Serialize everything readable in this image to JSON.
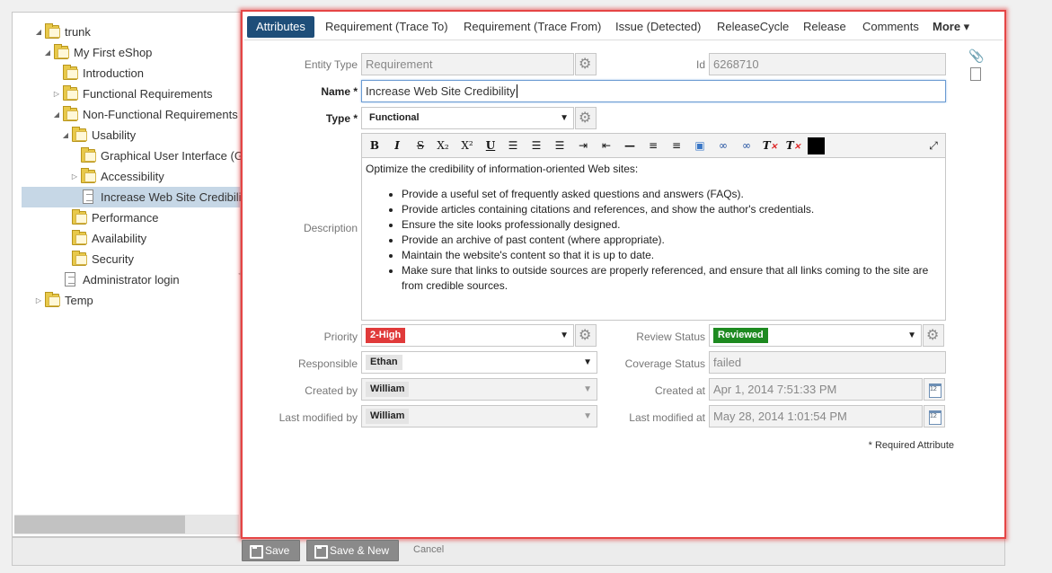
{
  "tree": {
    "items": [
      {
        "label": "trunk",
        "icon": "folder-icon",
        "arrow": "◢"
      },
      {
        "label": "My First eShop",
        "icon": "folder-icon",
        "arrow": "◢"
      },
      {
        "label": "Introduction",
        "icon": "folder-icon",
        "arrow": ""
      },
      {
        "label": "Functional Requirements",
        "icon": "folder-icon",
        "arrow": "▷"
      },
      {
        "label": "Non-Functional Requirements",
        "icon": "folder-icon",
        "arrow": "◢"
      },
      {
        "label": "Usability",
        "icon": "folder-icon",
        "arrow": "◢"
      },
      {
        "label": "Graphical User Interface (GU",
        "icon": "folder-icon",
        "arrow": ""
      },
      {
        "label": "Accessibility",
        "icon": "folder-icon",
        "arrow": "▷"
      },
      {
        "label": "Increase Web Site Credibility",
        "icon": "document-icon",
        "arrow": ""
      },
      {
        "label": "Performance",
        "icon": "folder-icon",
        "arrow": ""
      },
      {
        "label": "Availability",
        "icon": "folder-icon",
        "arrow": ""
      },
      {
        "label": "Security",
        "icon": "folder-icon",
        "arrow": ""
      },
      {
        "label": "Administrator login",
        "icon": "document-icon",
        "arrow": ""
      },
      {
        "label": "Temp",
        "icon": "folder-icon",
        "arrow": "▷"
      }
    ]
  },
  "tabs": [
    "Attributes",
    "Requirement (Trace To)",
    "Requirement (Trace From)",
    "Issue (Detected)",
    "ReleaseCycle",
    "Release",
    "Comments",
    "More ▾"
  ],
  "form": {
    "entity_type": {
      "label": "Entity Type",
      "value": "Requirement"
    },
    "id": {
      "label": "Id",
      "value": "6268710"
    },
    "name": {
      "label": "Name *",
      "value": "Increase Web Site Credibility"
    },
    "type": {
      "label": "Type *",
      "value": "Functional"
    },
    "description": {
      "label": "Description",
      "intro": "Optimize the credibility of information-oriented Web sites:",
      "bullets": [
        "Provide a useful set of frequently asked questions and answers (FAQs).",
        "Provide articles containing citations and references, and show the author's credentials.",
        "Ensure the site looks professionally designed.",
        "Provide an archive of past content (where appropriate).",
        "Maintain the website's content so that it is up to date.",
        "Make sure that links to outside sources are properly referenced, and ensure that all links coming to the site are from credible sources."
      ]
    },
    "priority": {
      "label": "Priority",
      "value": "2-High",
      "color": "#e03a3a"
    },
    "review_status": {
      "label": "Review Status",
      "value": "Reviewed",
      "color": "#1d8a20"
    },
    "responsible": {
      "label": "Responsible",
      "value": "Ethan"
    },
    "coverage_status": {
      "label": "Coverage Status",
      "value": "failed"
    },
    "created_by": {
      "label": "Created by",
      "value": "William"
    },
    "created_at": {
      "label": "Created at",
      "value": "Apr 1, 2014 7:51:33 PM"
    },
    "last_modified_by": {
      "label": "Last modified by",
      "value": "William"
    },
    "last_modified_at": {
      "label": "Last modified at",
      "value": "May 28, 2014 1:01:54 PM"
    },
    "required_note": "* Required Attribute"
  },
  "toolbar": {
    "bold": "B",
    "italic": "I",
    "strike": "S",
    "subscript": "X₂",
    "superscript": "X²",
    "underline": "U"
  },
  "footer": {
    "save": "Save",
    "save_new": "Save & New",
    "cancel": "Cancel"
  },
  "colors": {
    "accent": "#1e4e79",
    "highlight_border": "#e54545",
    "selection": "#c6d7e6"
  }
}
